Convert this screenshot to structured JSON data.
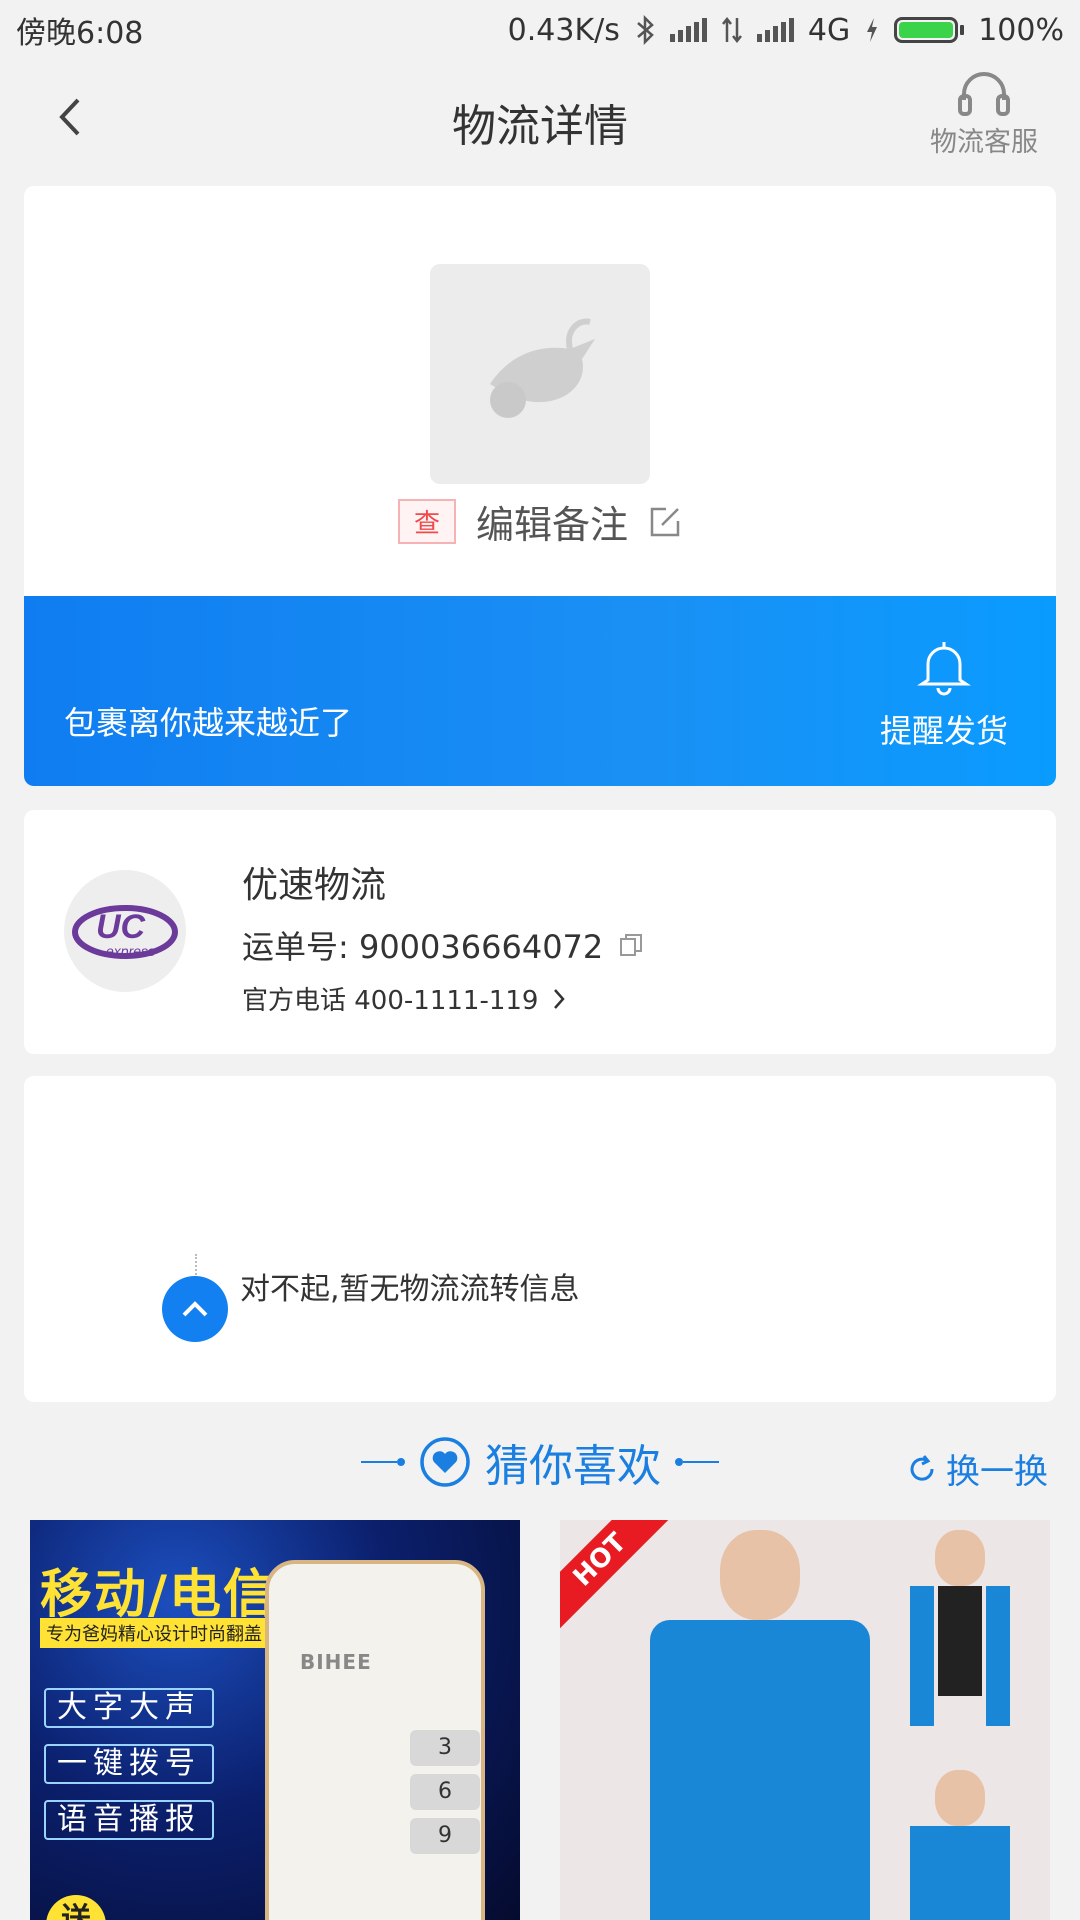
{
  "status_bar": {
    "time": "傍晚6:08",
    "speed": "0.43K/s",
    "network": "4G",
    "battery": "100%"
  },
  "header": {
    "title": "物流详情",
    "service_label": "物流客服"
  },
  "package": {
    "tag": "查",
    "note_label": "编辑备注",
    "banner_text": "包裹离你越来越近了",
    "remind_label": "提醒发货"
  },
  "courier": {
    "name": "优速物流",
    "logo_text": "UC",
    "logo_sub": "express",
    "waybill": "运单号: 900036664072",
    "phone": "官方电话 400-1111-119"
  },
  "tracking": {
    "empty_message": "对不起,暂无物流流转信息"
  },
  "recommend": {
    "title": "猜你喜欢",
    "refresh": "换一换",
    "items": [
      {
        "headline": "移动/电信",
        "subline": "专为爸妈精心设计时尚翻盖",
        "features": [
          "大字大声",
          "一键拨号",
          "语音播报"
        ],
        "brand": "BIHEE",
        "badge": "送"
      },
      {
        "badge": "HOT"
      }
    ]
  },
  "colors": {
    "accent": "#1a7fe0",
    "banner": "#0f7df1",
    "tag_red": "#f04b4b"
  }
}
